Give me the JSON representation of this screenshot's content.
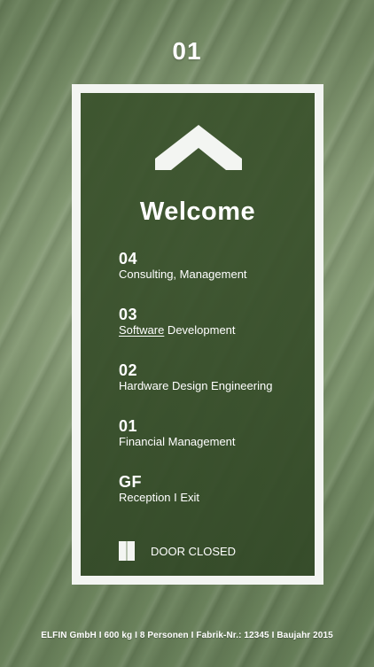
{
  "display": {
    "current_floor": "01",
    "welcome_text": "Welcome",
    "direction_icon": "chevron-up-icon"
  },
  "floors": [
    {
      "number": "04",
      "label": "Consulting, Management"
    },
    {
      "number": "03",
      "label_part1": "Software",
      "label_part2": " Development"
    },
    {
      "number": "02",
      "label": "Hardware Design Engineering"
    },
    {
      "number": "01",
      "label": "Financial Management"
    },
    {
      "number": "GF",
      "label": "Reception    I Exit"
    }
  ],
  "door": {
    "status_text": "DOOR CLOSED",
    "icon": "door-closed-icon"
  },
  "footer": {
    "text": "ELFIN GmbH I 600 kg I 8 Personen I Fabrik-Nr.: 12345 I Baujahr 2015"
  },
  "colors": {
    "frame": "#f3f5f2",
    "background": "#7c9468",
    "panel": "#3f5a2f",
    "text": "#ffffff"
  }
}
